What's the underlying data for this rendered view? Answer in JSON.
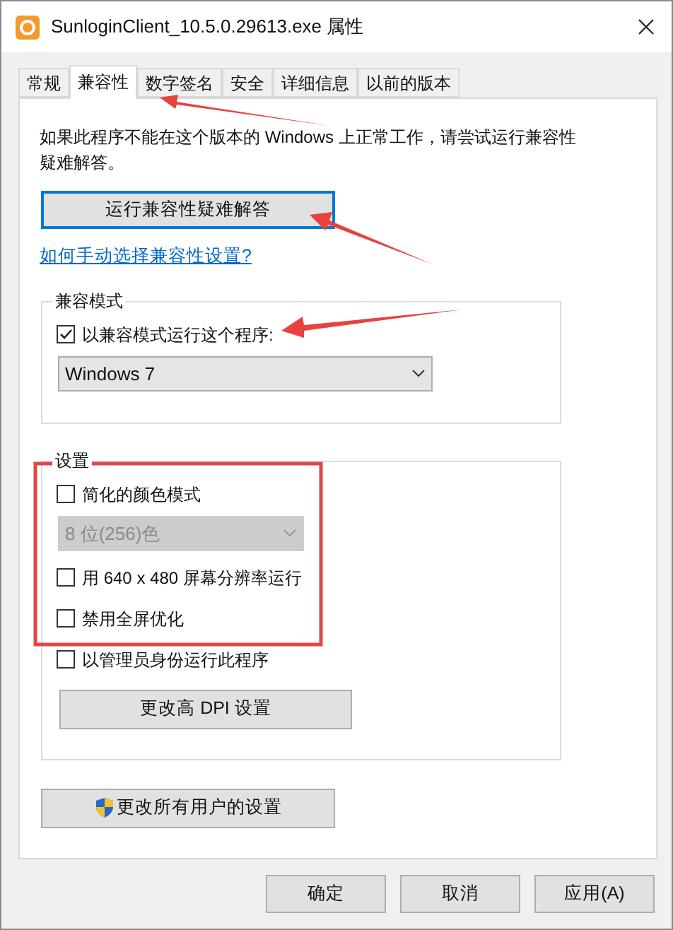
{
  "window": {
    "title": "SunloginClient_10.5.0.29613.exe 属性"
  },
  "tabs": [
    {
      "label": "常规",
      "selected": false
    },
    {
      "label": "兼容性",
      "selected": true
    },
    {
      "label": "数字签名",
      "selected": false
    },
    {
      "label": "安全",
      "selected": false
    },
    {
      "label": "详细信息",
      "selected": false
    },
    {
      "label": "以前的版本",
      "selected": false
    }
  ],
  "intro": "如果此程序不能在这个版本的 Windows 上正常工作，请尝试运行兼容性疑难解答。",
  "troubleshoot_button": "运行兼容性疑难解答",
  "help_link": "如何手动选择兼容性设置?",
  "compat_mode": {
    "title": "兼容模式",
    "items": [
      {
        "kind": "checkbox",
        "label": "以兼容模式运行这个程序:",
        "checked": true
      },
      {
        "kind": "dropdown",
        "value": "Windows 7",
        "disabled": false
      }
    ]
  },
  "settings": {
    "title": "设置",
    "items": [
      {
        "kind": "checkbox",
        "label": "简化的颜色模式",
        "checked": false
      },
      {
        "kind": "dropdown",
        "value": "8 位(256)色",
        "disabled": true
      },
      {
        "kind": "checkbox",
        "label": "用 640 x 480 屏幕分辨率运行",
        "checked": false
      },
      {
        "kind": "checkbox",
        "label": "禁用全屏优化",
        "checked": false
      },
      {
        "kind": "checkbox",
        "label": "以管理员身份运行此程序",
        "checked": false
      },
      {
        "kind": "button",
        "label": "更改高 DPI 设置"
      }
    ]
  },
  "all_users_button": "更改所有用户的设置",
  "buttons": [
    "确定",
    "取消",
    "应用(A)"
  ]
}
